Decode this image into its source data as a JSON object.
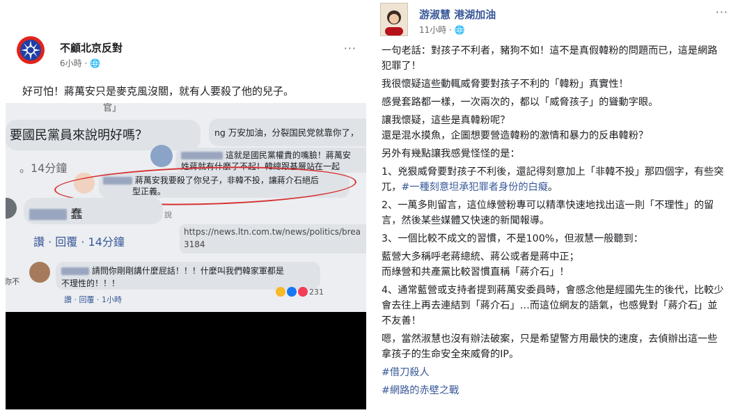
{
  "left_post": {
    "page_name": "不顧北京反對",
    "time": "6小時 · ",
    "more": "···",
    "text": "好可怕！蔣萬安只是麥克風沒關，就有人要殺了他的兒子。"
  },
  "screenshot": {
    "snippet_top": "官」",
    "comment_question": "要國民黨員來說明好嗎？",
    "comment_ng": "ng 万安加油，分裂国民党就靠你了，",
    "comment_time1": "。14分鐘",
    "reply_a_line1": "這就是國民黨權貴的嘴臉！蔣萬安",
    "reply_a_line2": "姓蔣就有什麼了不起！韓總跟基層站在一起",
    "circled_line1": "蔣萬安我要殺了你兒子，非韓不投，讓蔣介石絕后",
    "circled_line2": "型正義。",
    "name_chun": "蠢",
    "extra": "說",
    "actions": "讚 · 回覆 · 14分鐘",
    "link_line1": "https://news.ltn.com.tw/news/politics/brea",
    "link_line2": "3184",
    "bottom_line1": "請問你剛剛講什麼屁話！！！什麼叫我們韓家軍都是",
    "bottom_line2": "不理性的！！！",
    "side_char": "你不",
    "reaction_count": "231",
    "bottom_actions": "讚 · 回覆 · 1小時"
  },
  "right_post": {
    "page_name": "游淑慧 港湖加油",
    "time": "11小時 · ",
    "more": "···",
    "p1": "一句老話：對孩子不利者，豬狗不如！這不是真假韓粉的問題而已，這是網路犯罪了！",
    "p2": "我很懷疑這些動輒威脅要對孩子不利的「韓粉」真實性！",
    "p3": "感覺套路都一樣，一次兩次的，都以「威脅孩子」的聳動字眼。",
    "p4a": "讓我懷疑，這些是真韓粉呢？",
    "p4b": "還是混水摸魚，企圖想要營造韓粉的激情和暴力的反串韓粉？",
    "p5": "另外有幾點讓我感覺怪怪的是：",
    "p6a": "1、兇狠威脅要對孩子不利後，還記得刻意加上「非韓不投」那四個字，有些突兀，",
    "p6tag": "#一種刻意坦承犯罪者身份的白癡",
    "p6end": "。",
    "p7": "2、一萬多則留言，這位綠營粉專可以精準快速地找出這一則「不理性」的留言，然後某些媒體又快速的新聞報導。",
    "p8": "3、一個比較不成文的習慣，不是100%，但淑慧一般聽到：",
    "p9a": "藍營大多稱呼老蔣總統、蔣公或者是蔣中正；",
    "p9b": "而綠營和共產黨比較習慣直稱「蔣介石」！",
    "p10": "4、通常藍營或支持者提到蔣萬安委員時，會感念他是經國先生的後代，比較少會去往上再去連結到「蔣介石」…而這位網友的語氣，也感覺對「蔣介石」並不友善！",
    "p11": "嗯，當然淑慧也沒有辦法破案，只是希望警方用最快的速度，去偵辦出這一些拿孩子的生命安全來威脅的IP。",
    "tag1": "#借刀殺人",
    "tag2": "#網路的赤壁之戰"
  },
  "colors": {
    "kmt_blue": "#1f3fa6",
    "kmt_red": "#e2231a",
    "link": "#385898",
    "circle": "#d63232"
  }
}
